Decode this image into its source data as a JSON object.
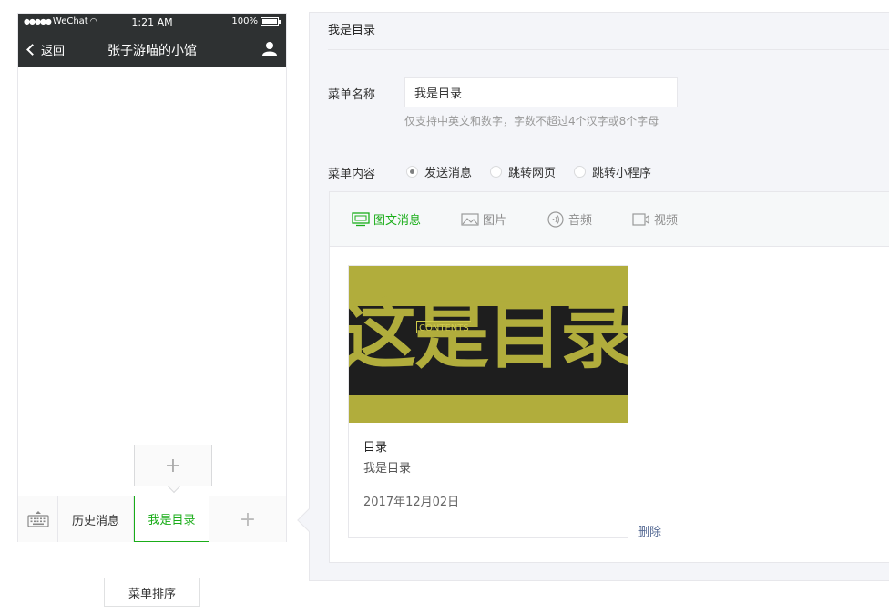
{
  "phone": {
    "status": {
      "carrier": "WeChat",
      "time": "1:21 AM",
      "battery": "100%"
    },
    "nav": {
      "back_label": "返回",
      "title": "张子游喵的小馆"
    },
    "menu": {
      "items": [
        {
          "label": "历史消息"
        },
        {
          "label": "我是目录"
        }
      ],
      "selected_index": 1,
      "add_symbol": "+",
      "sub_add_symbol": "+"
    },
    "sort_button": "菜单排序"
  },
  "editor": {
    "header_title": "我是目录",
    "name_label": "菜单名称",
    "name_value": "我是目录",
    "name_hint": "仅支持中英文和数字，字数不超过4个汉字或8个字母",
    "content_label": "菜单内容",
    "radio_options": [
      {
        "label": "发送消息",
        "checked": true
      },
      {
        "label": "跳转网页",
        "checked": false
      },
      {
        "label": "跳转小程序",
        "checked": false
      }
    ],
    "content_tabs": [
      {
        "label": "图文消息",
        "icon": "news-icon",
        "active": true
      },
      {
        "label": "图片",
        "icon": "image-icon",
        "active": false
      },
      {
        "label": "音频",
        "icon": "audio-icon",
        "active": false
      },
      {
        "label": "视频",
        "icon": "video-icon",
        "active": false
      }
    ],
    "article": {
      "cover_text": "这是目录",
      "cover_tag": "CONTENTS",
      "title": "目录",
      "digest": "我是目录",
      "date": "2017年12月02日"
    },
    "delete_label": "删除"
  },
  "colors": {
    "accent": "#1aad19",
    "phone_header": "#2e3132",
    "editor_bg": "#f4f5f9",
    "link": "#576b95",
    "cover_olive": "#b1ad3c"
  }
}
